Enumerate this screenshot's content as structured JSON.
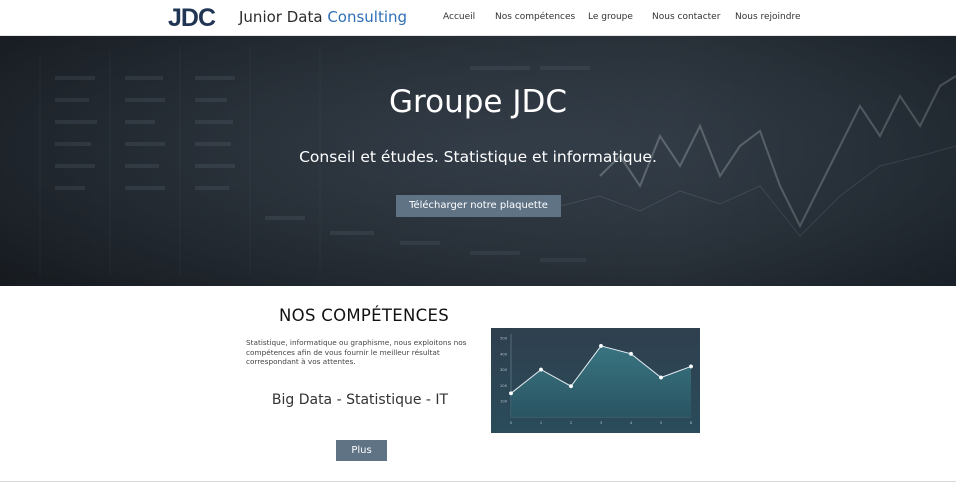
{
  "header": {
    "logo_mark": "JDC",
    "brand_text": "Junior Data",
    "brand_accent": "Consulting",
    "nav": [
      "Accueil",
      "Nos compétences",
      "Le groupe",
      "Nous contacter",
      "Nous rejoindre"
    ]
  },
  "hero": {
    "title": "Groupe JDC",
    "subtitle": "Conseil et études. Statistique et informatique.",
    "button_label": "Télécharger notre plaquette"
  },
  "competences": {
    "title": "NOS COMPÉTENCES",
    "description": "Statistique, informatique ou graphisme, nous exploitons nos compétences afin de vous fournir le meilleur résultat correspondant à vos attentes.",
    "tagline": "Big Data - Statistique - IT",
    "more_label": "Plus"
  },
  "chart_data": {
    "type": "area",
    "x": [
      0,
      1,
      2,
      3,
      4,
      5,
      6
    ],
    "values": [
      150,
      300,
      195,
      450,
      400,
      250,
      320
    ],
    "ylim": [
      0,
      500
    ],
    "y_ticks": [
      100,
      200,
      300,
      400,
      500
    ],
    "x_tick_labels": [
      "0",
      "1",
      "2",
      "3",
      "4",
      "5",
      "6"
    ],
    "y_tick_labels": [
      "100",
      "200",
      "300",
      "400",
      "500"
    ],
    "grid": false,
    "colors": {
      "line": "#e6eef2",
      "fill_top": "#3a7a86",
      "fill_bottom": "#2a5563",
      "point": "#ffffff"
    }
  },
  "colors": {
    "button": "#5f7385",
    "brand": "#1f3553",
    "accent": "#2f6fb5"
  }
}
